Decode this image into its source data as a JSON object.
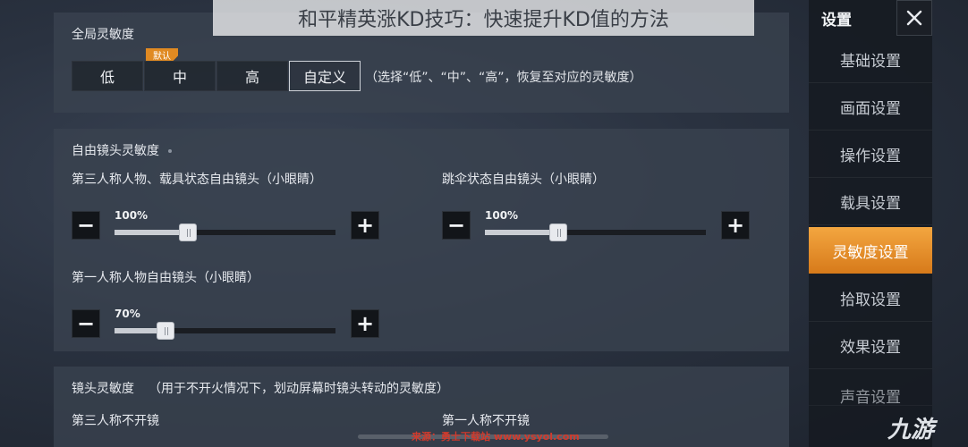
{
  "banner": "和平精英涨KD技巧：快速提升KD值的方法",
  "global": {
    "title": "全局灵敏度",
    "badge": "默认",
    "options": [
      "低",
      "中",
      "高",
      "自定义"
    ],
    "selected": "自定义",
    "hint": "（选择“低”、“中”、“高”，恢复至对应的灵敏度）"
  },
  "free_look": {
    "title": "自由镜头灵敏度",
    "sliders": [
      {
        "label": "第三人称人物、载具状态自由镜头（小眼睛）",
        "value_text": "100%",
        "fraction": 0.33
      },
      {
        "label": "跳伞状态自由镜头（小眼睛）",
        "value_text": "100%",
        "fraction": 0.33
      },
      {
        "label": "第一人称人物自由镜头（小眼睛）",
        "value_text": "70%",
        "fraction": 0.23
      }
    ],
    "minus": "−",
    "plus": "+"
  },
  "scope": {
    "title": "镜头灵敏度",
    "note": "（用于不开火情况下，划动屏幕时镜头转动的灵敏度）",
    "col1": "第三人称不开镜",
    "col2": "第一人称不开镜"
  },
  "sidebar": {
    "title": "设置",
    "items": [
      "基础设置",
      "画面设置",
      "操作设置",
      "载具设置",
      "灵敏度设置",
      "拾取设置",
      "效果设置",
      "声音设置"
    ],
    "active": "灵敏度设置"
  },
  "watermark": {
    "source": "来源：勇士下载站 www.ysyol.com",
    "logo": "九游"
  },
  "colors": {
    "accent": "#e58f2a"
  }
}
